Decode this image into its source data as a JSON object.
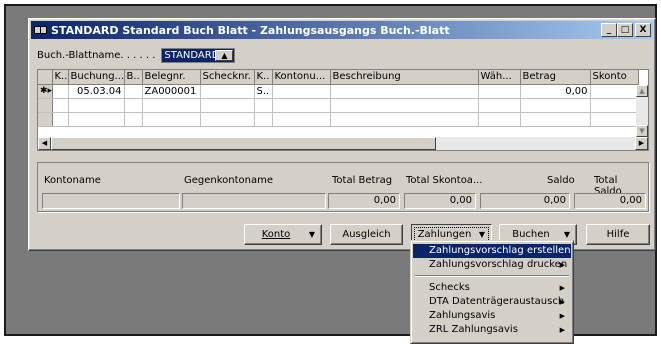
{
  "window": {
    "title": "STANDARD Standard Buch Blatt - Zahlungsausgangs Buch.-Blatt",
    "min_label": "_",
    "max_label": "□",
    "close_label": "X"
  },
  "journal": {
    "label": "Buch.-Blattname. . . . . .",
    "value": "STANDARD",
    "lookup_icon": "up-arrow-icon"
  },
  "grid": {
    "columns": [
      "",
      "K..",
      "Buchung...",
      "B..",
      "Belegnr.",
      "Schecknr.",
      "K..",
      "Kontonu...",
      "Beschreibung",
      "Wäh...",
      "Betrag",
      "Skonto"
    ],
    "rows": [
      {
        "marker": "✱▸",
        "cells": [
          "",
          "05.03.04",
          "",
          "ZA000001",
          "",
          "S..",
          "",
          "",
          "",
          "0,00",
          ""
        ]
      },
      {
        "marker": "",
        "cells": [
          "",
          "",
          "",
          "",
          "",
          "",
          "",
          "",
          "",
          "",
          ""
        ]
      },
      {
        "marker": "",
        "cells": [
          "",
          "",
          "",
          "",
          "",
          "",
          "",
          "",
          "",
          "",
          ""
        ]
      }
    ]
  },
  "totals": {
    "labels": {
      "kontoname": "Kontoname",
      "gegenkontoname": "Gegenkontoname",
      "total_betrag": "Total Betrag",
      "total_skonto": "Total Skontoa...",
      "saldo": "Saldo",
      "total_saldo": "Total Saldo"
    },
    "values": {
      "kontoname": "",
      "gegenkontoname": "",
      "total_betrag": "0,00",
      "total_skonto": "0,00",
      "saldo": "0,00",
      "total_saldo": "0,00"
    }
  },
  "buttons": {
    "konto": "Konto",
    "ausgleich": "Ausgleich",
    "zahlungen": "Zahlungen",
    "buchen": "Buchen",
    "hilfe": "Hilfe"
  },
  "menu": {
    "items": [
      {
        "label": "Zahlungsvorschlag erstellen",
        "submenu": false,
        "highlighted": true
      },
      {
        "label": "Zahlungsvorschlag drucken",
        "submenu": true,
        "highlighted": false
      },
      {
        "label": "Schecks",
        "submenu": true,
        "highlighted": false
      },
      {
        "label": "DTA Datenträgeraustausch",
        "submenu": true,
        "highlighted": false
      },
      {
        "label": "Zahlungsavis",
        "submenu": true,
        "highlighted": false
      },
      {
        "label": "ZRL Zahlungsavis",
        "submenu": true,
        "highlighted": false
      }
    ]
  },
  "colors": {
    "title_start": "#0a246a",
    "title_end": "#a6caf0",
    "face": "#d4d0c8",
    "highlight": "#0a246a",
    "background": "#7a7a7a"
  }
}
